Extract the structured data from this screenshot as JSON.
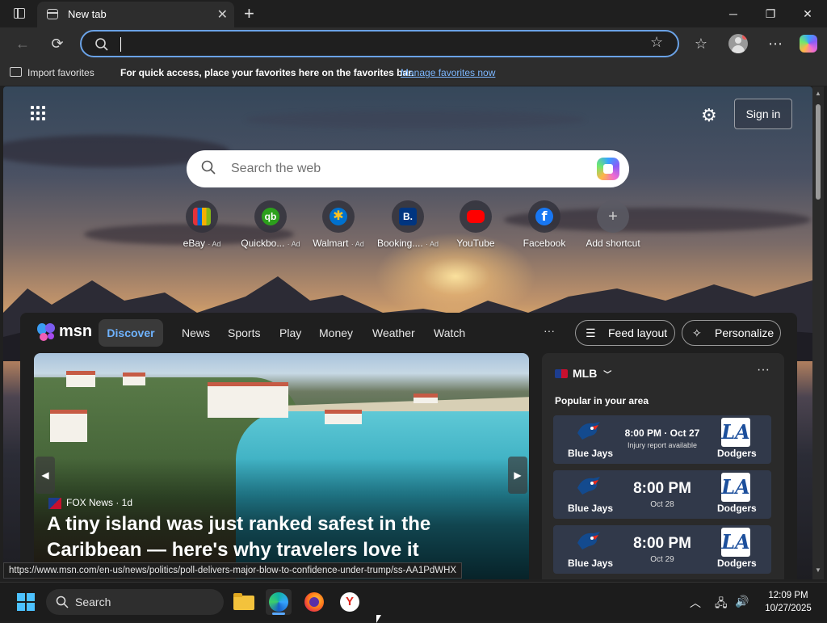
{
  "browser": {
    "tab_title": "New tab",
    "address_value": "",
    "favorites_bar": {
      "import_label": "Import favorites",
      "hint": "For quick access, place your favorites here on the favorites bar.",
      "manage_link": "Manage favorites now"
    }
  },
  "newtab": {
    "sign_in": "Sign in",
    "search_placeholder": "Search the web",
    "shortcuts": [
      {
        "label": "eBay",
        "ad": "· Ad",
        "icon": "ebay-icon"
      },
      {
        "label": "Quickbo...",
        "ad": "· Ad",
        "icon": "quickbooks-icon"
      },
      {
        "label": "Walmart",
        "ad": "· Ad",
        "icon": "walmart-icon"
      },
      {
        "label": "Booking....",
        "ad": "· Ad",
        "icon": "booking-icon"
      },
      {
        "label": "YouTube",
        "ad": "",
        "icon": "youtube-icon"
      },
      {
        "label": "Facebook",
        "ad": "",
        "icon": "facebook-icon"
      },
      {
        "label": "Add shortcut",
        "ad": "",
        "icon": "plus-icon"
      }
    ]
  },
  "msn": {
    "logo_text": "msn",
    "nav": [
      "Discover",
      "News",
      "Sports",
      "Play",
      "Money",
      "Weather",
      "Watch"
    ],
    "more": "···",
    "feed_layout": "Feed layout",
    "personalize": "Personalize",
    "hero": {
      "source": "FOX News · 1d",
      "headline": "A tiny island was just ranked safest in the Caribbean — here's why travelers love it"
    },
    "mlb": {
      "title": "MLB",
      "subtitle": "Popular in your area",
      "more": "···",
      "games": [
        {
          "away": "Blue Jays",
          "home": "Dodgers",
          "time": "8:00 PM · Oct 27",
          "note": "Injury report available",
          "home_logo": "LA"
        },
        {
          "away": "Blue Jays",
          "home": "Dodgers",
          "time": "8:00 PM",
          "note": "Oct 28",
          "home_logo": "LA"
        },
        {
          "away": "Blue Jays",
          "home": "Dodgers",
          "time": "8:00 PM",
          "note": "Oct 29",
          "home_logo": "LA"
        }
      ]
    }
  },
  "status_url": "https://www.msn.com/en-us/news/politics/poll-delivers-major-blow-to-confidence-under-trump/ss-AA1PdWHX",
  "taskbar": {
    "search_label": "Search",
    "time": "12:09 PM",
    "date": "10/27/2025"
  },
  "colors": {
    "accent": "#6aa2e6",
    "link": "#7cb7ff",
    "discover_active": "#6fb3ff"
  }
}
